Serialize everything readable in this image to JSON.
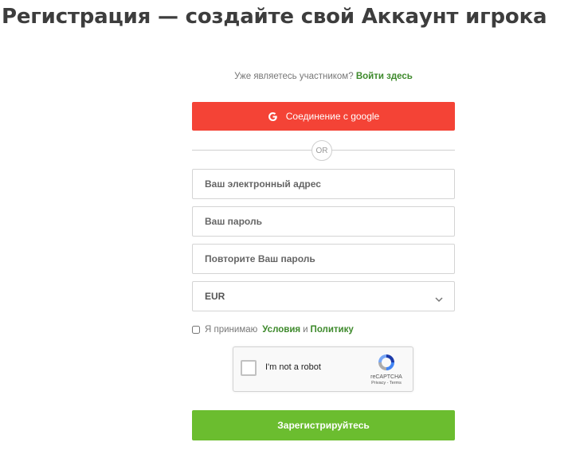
{
  "page": {
    "title": "Регистрация — создайте свой Аккаунт игрока"
  },
  "login_prompt": {
    "text": "Уже являетесь участником?",
    "link": "Войти здесь"
  },
  "google": {
    "label": "Соединение с google",
    "icon": "google-icon"
  },
  "divider": {
    "label": "OR"
  },
  "fields": {
    "email_placeholder": "Ваш электронный адрес",
    "password_placeholder": "Ваш пароль",
    "repeat_password_placeholder": "Повторите Ваш пароль",
    "currency_value": "EUR"
  },
  "terms": {
    "prefix": "Я принимаю",
    "conditions_link": "Условия",
    "and": "и",
    "policy_link": "Политику"
  },
  "recaptcha": {
    "label": "I'm not a robot",
    "brand": "reCAPTCHA",
    "privacy": "Privacy",
    "separator": " - ",
    "terms": "Terms"
  },
  "submit": {
    "label": "Зарегистрируйтесь"
  },
  "colors": {
    "google_red": "#f44336",
    "submit_green": "#6bbd2f",
    "link_green": "#3e8a2c"
  }
}
